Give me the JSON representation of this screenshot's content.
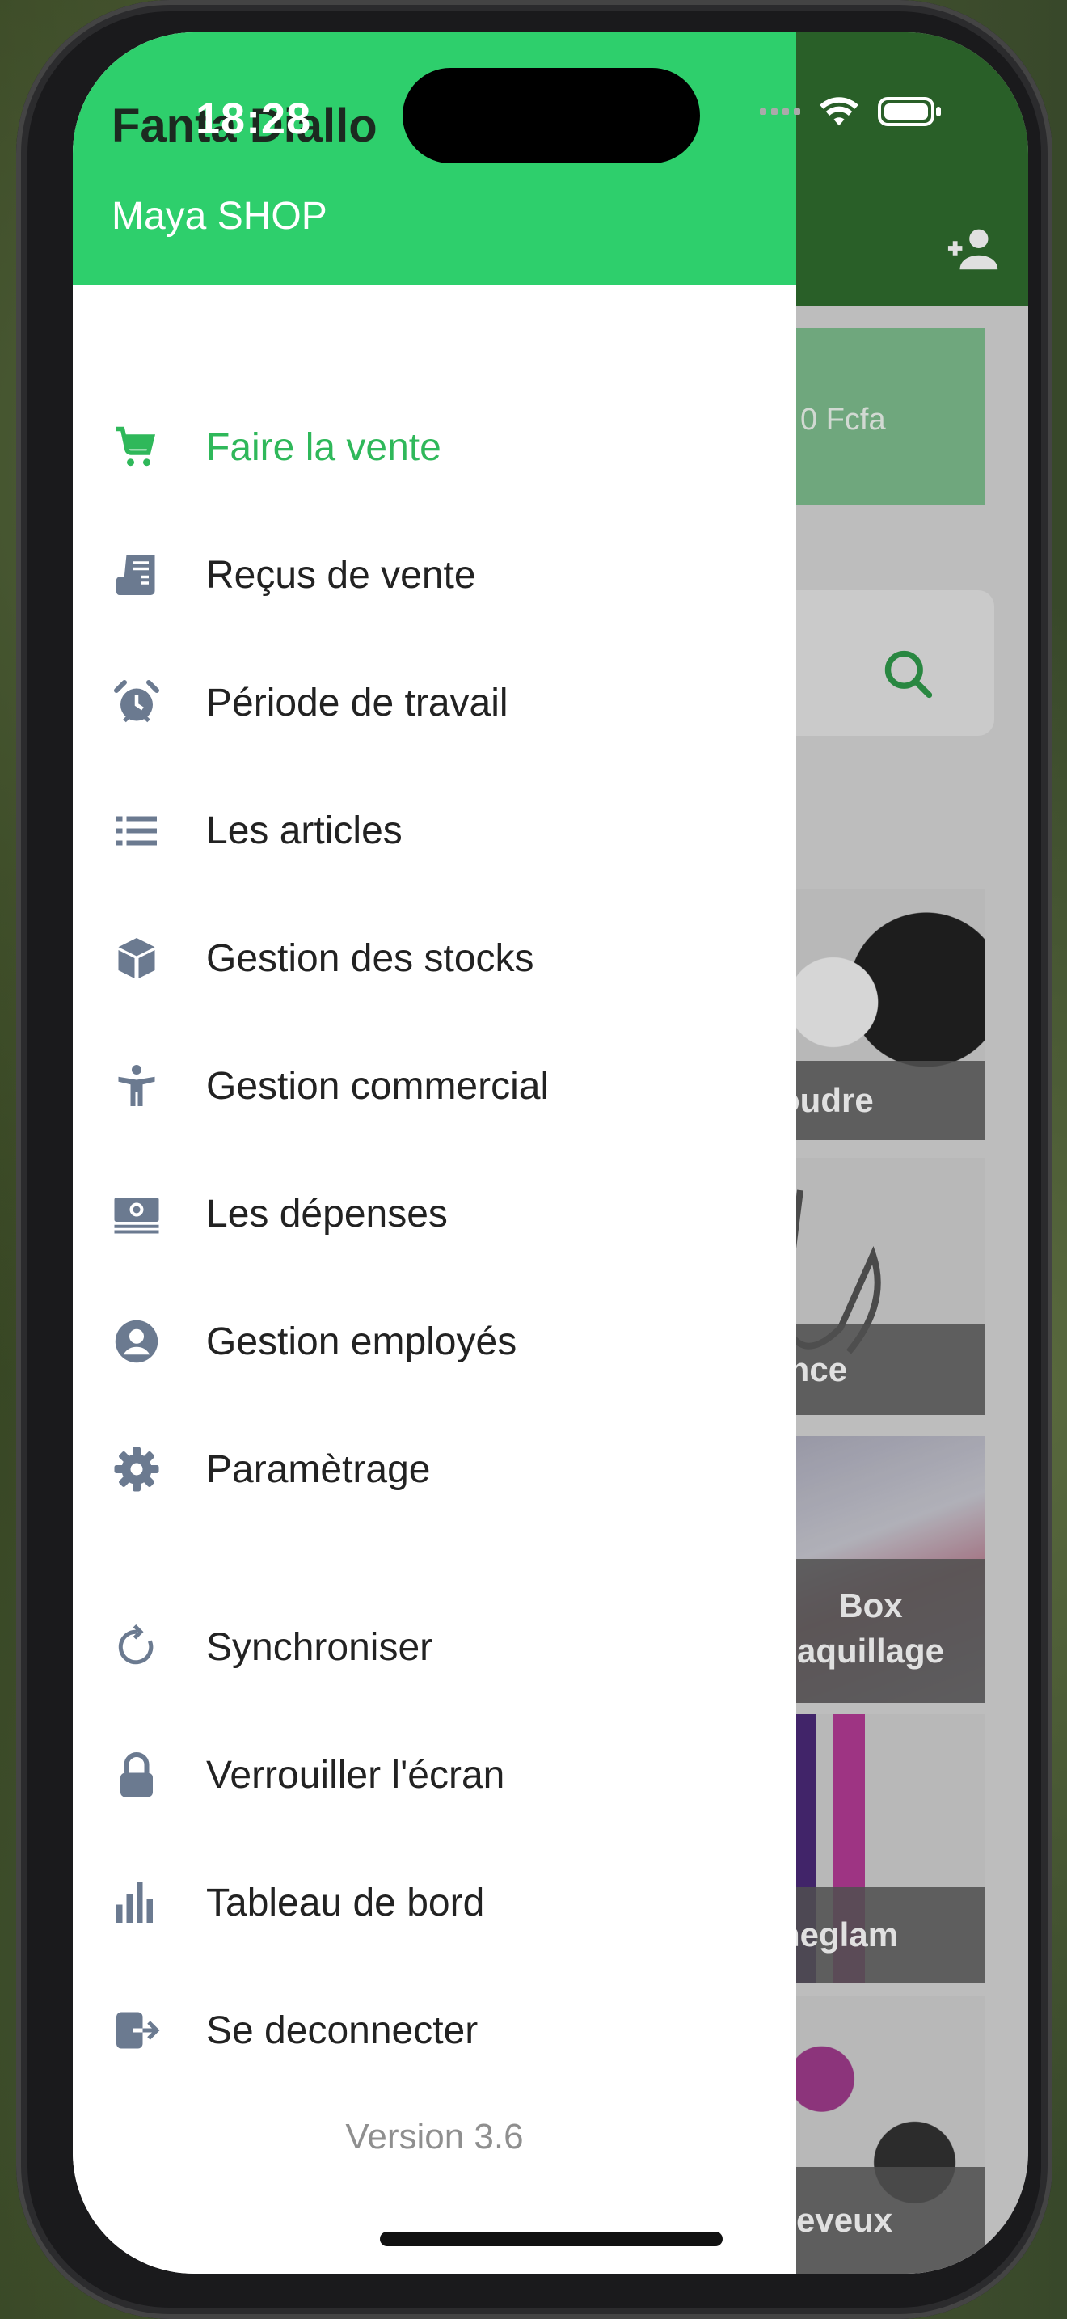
{
  "status_bar": {
    "time": "18:28"
  },
  "drawer": {
    "user_name": "Fanta Diallo",
    "shop_name": "Maya SHOP",
    "menu": [
      {
        "label": "Faire la vente",
        "icon": "cart-icon",
        "active": true
      },
      {
        "label": "Reçus de vente",
        "icon": "receipt-icon"
      },
      {
        "label": "Période de travail",
        "icon": "alarm-clock-icon"
      },
      {
        "label": "Les articles",
        "icon": "list-icon"
      },
      {
        "label": "Gestion des stocks",
        "icon": "box-icon"
      },
      {
        "label": "Gestion commercial",
        "icon": "person-icon"
      },
      {
        "label": "Les dépenses",
        "icon": "money-icon"
      },
      {
        "label": "Gestion employés",
        "icon": "user-circle-icon"
      },
      {
        "label": "Paramètrage",
        "icon": "gear-icon"
      },
      {
        "label": "Synchroniser",
        "icon": "sync-icon"
      },
      {
        "label": "Verrouiller l'écran",
        "icon": "lock-icon"
      },
      {
        "label": "Tableau de bord",
        "icon": "bar-chart-icon"
      },
      {
        "label": "Se deconnecter",
        "icon": "logout-icon"
      }
    ],
    "version": "Version 3.6"
  },
  "background_app": {
    "total": "0 Fcfa",
    "categories": [
      "Poudre",
      "Pince",
      "Box\naquillage",
      "Sheglam",
      "cheveux"
    ]
  },
  "colors": {
    "accent": "#2ecf6c",
    "active_text": "#2fb85a",
    "header_dark": "#2f6d2e",
    "icon_gray": "#6b7a90"
  }
}
